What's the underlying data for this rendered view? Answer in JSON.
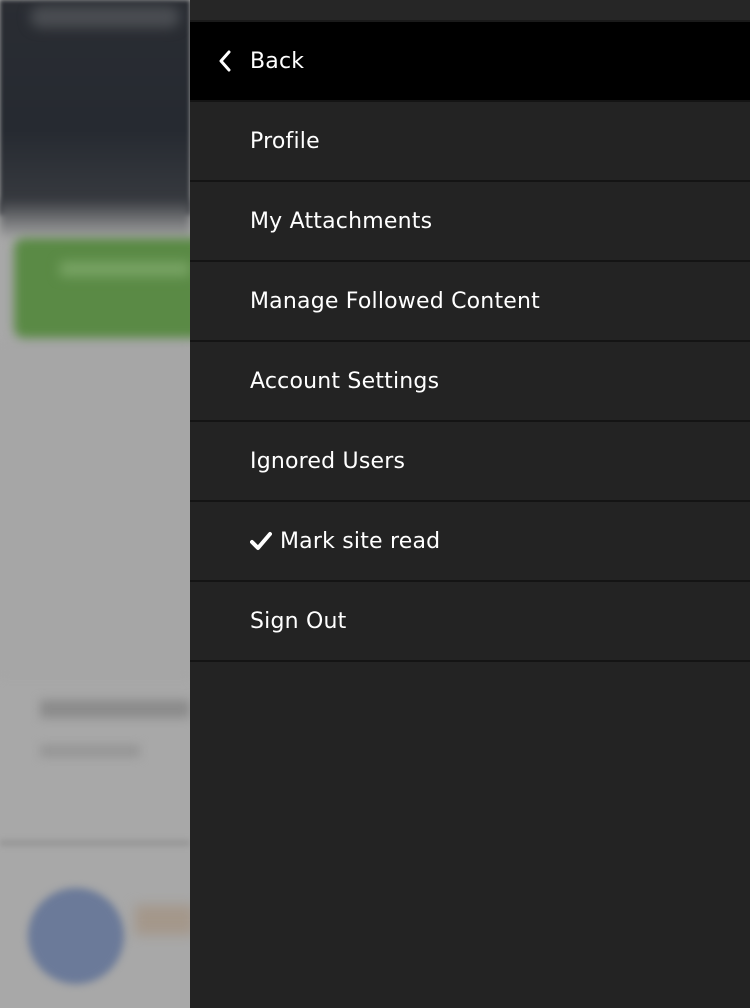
{
  "menu": {
    "back_label": "Back",
    "items": [
      {
        "label": "Profile"
      },
      {
        "label": "My Attachments"
      },
      {
        "label": "Manage Followed Content"
      },
      {
        "label": "Account Settings"
      },
      {
        "label": "Ignored Users"
      },
      {
        "label": "Mark site read",
        "icon": "checkmark-icon"
      },
      {
        "label": "Sign Out"
      }
    ]
  },
  "icons": {
    "back": "chevron-left-icon",
    "mark_read": "checkmark-icon"
  },
  "colors": {
    "drawer_bg": "#232323",
    "back_bg": "#000000",
    "text": "#ffffff",
    "divider": "#141414"
  }
}
